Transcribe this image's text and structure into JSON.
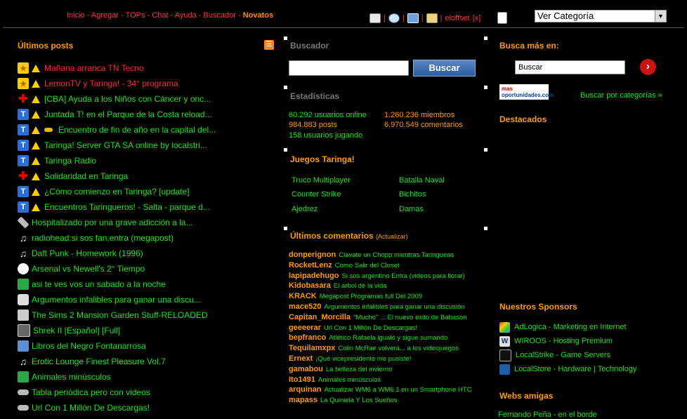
{
  "nav": {
    "items": [
      {
        "label": "Inicio",
        "active": false
      },
      {
        "label": "Agregar",
        "active": false
      },
      {
        "label": "TOPs",
        "active": false
      },
      {
        "label": "Chat",
        "active": false
      },
      {
        "label": "Ayuda",
        "active": false
      },
      {
        "label": "Buscador",
        "active": false
      },
      {
        "label": "Novatos",
        "active": true
      }
    ],
    "user": "eloffset",
    "close": "[x]",
    "category_select": "Ver Categoría"
  },
  "left": {
    "title": "Últimos posts",
    "posts": [
      {
        "title": "Mañana arranca TN Tecno",
        "icon": "star-icon",
        "color": "red",
        "warn": true
      },
      {
        "title": "LemonTV y Taringa! - 34° programa",
        "icon": "star-icon",
        "color": "red",
        "warn": true
      },
      {
        "title": "[CBA] Ayuda a los Niños con Cáncer y onc...",
        "icon": "red-cross-icon",
        "color": "green",
        "warn": true
      },
      {
        "title": "Juntada T! en el Parque de la Costa reload...",
        "icon": "taringa-t-icon",
        "color": "green",
        "warn": true
      },
      {
        "title": "Encuentro de fin de año en la capital del...",
        "icon": "taringa-t-icon",
        "color": "green",
        "warn": true,
        "key": true
      },
      {
        "title": "Taringa! Server GTA SA online by localstri...",
        "icon": "taringa-t-icon",
        "color": "green",
        "warn": true
      },
      {
        "title": "Taringa Radio",
        "icon": "taringa-t-icon",
        "color": "green",
        "warn": true
      },
      {
        "title": "Solidaridad en Taringa",
        "icon": "red-cross-icon",
        "color": "green",
        "warn": true
      },
      {
        "title": "¿Cómo comienzo en Taringa? [update]",
        "icon": "taringa-t-icon",
        "color": "green",
        "warn": true
      },
      {
        "title": "Encuentros Taringueros! - Salta - parque d...",
        "icon": "taringa-t-icon",
        "color": "green",
        "warn": true
      },
      {
        "title": "Hospitalizado por una grave adicción a la...",
        "icon": "bandage-icon",
        "color": "green",
        "warn": false
      },
      {
        "title": "radiohead:si sos fan,entra (megapost)",
        "icon": "music-note-icon",
        "color": "green",
        "warn": false
      },
      {
        "title": "Daft Punk - Homework (1996)",
        "icon": "music-note-icon",
        "color": "green",
        "warn": false
      },
      {
        "title": "Arsenal vs Newell's 2° Tiempo",
        "icon": "soccer-ball-icon",
        "color": "green",
        "warn": false
      },
      {
        "title": "asi te ves vos un sabado a la noche",
        "icon": "image-icon",
        "color": "green",
        "warn": false
      },
      {
        "title": "Argumentos infalibles para ganar una discu...",
        "icon": "chat-icon",
        "color": "green",
        "warn": false
      },
      {
        "title": "The Sims 2 Mansion Garden Stuff-RELOADED",
        "icon": "gamepad-icon",
        "color": "green",
        "warn": false
      },
      {
        "title": "Shrek II [Español] [Full]",
        "icon": "film-icon",
        "color": "green",
        "warn": false
      },
      {
        "title": "Libros del Negro Fontanarrosa",
        "icon": "book-icon",
        "color": "green",
        "warn": false
      },
      {
        "title": "Erotic Lounge Finest Pleasure Vol.7",
        "icon": "music-note-icon",
        "color": "green",
        "warn": false
      },
      {
        "title": "Animales minúsculos",
        "icon": "image-icon",
        "color": "green",
        "warn": false
      },
      {
        "title": "Tabla periódica pero con videos",
        "icon": "link-icon",
        "color": "green",
        "warn": false
      },
      {
        "title": "Url Con 1 Millón De Descargas!",
        "icon": "link-icon",
        "color": "green",
        "warn": false
      }
    ]
  },
  "middle": {
    "search_title": "Buscador",
    "search_button": "Buscar",
    "stats_title": "Estadísticas",
    "stats": [
      {
        "text": "60.292 usuarios online",
        "color": "green"
      },
      {
        "text": "1.260.236 miembros",
        "color": "orange"
      },
      {
        "text": "984.883 posts",
        "color": "orange"
      },
      {
        "text": "6.970.549 comentarios",
        "color": "orange"
      },
      {
        "text": "158 usuarios jugando",
        "color": "green"
      }
    ],
    "games_title": "Juegos Taringa!",
    "games": [
      "Truco Multiplayer",
      "Batalla Naval",
      "Counter Strike",
      "Bichitos",
      "Ajedrez",
      "Damas"
    ],
    "comments_title": "Últimos comentarios",
    "comments_update": "(Actualizar)",
    "comments": [
      {
        "user": "donperignon",
        "text": "Clavate un Chopp mientras Taringueas"
      },
      {
        "user": "RocketLenz",
        "text": "Como Salir del Closet"
      },
      {
        "user": "lapipadehugo",
        "text": "Si sos argentino Entra (videos para llorar)"
      },
      {
        "user": "Kidobasara",
        "text": "El arbol de la vida"
      },
      {
        "user": "KRACK",
        "text": "Megapost Programas full Del 2009"
      },
      {
        "user": "mace520",
        "text": "Argumentos infalibles para ganar una discusión"
      },
      {
        "user": "Capitan_Morcilla",
        "text": "\"Mucho\" ... El nuevo exito de Babason"
      },
      {
        "user": "geeeerar",
        "text": "Url Con 1 Millón De Descargas!"
      },
      {
        "user": "bepfranco",
        "text": "Atlético Rafaela igualó y sigue sumando"
      },
      {
        "user": "Tequilamxpx",
        "text": "Colin McRae volverá... a los videojuegos"
      },
      {
        "user": "Ernext",
        "text": "¡Qué vicepresidente me pusiste!"
      },
      {
        "user": "gamabou",
        "text": "La belleza del invierno"
      },
      {
        "user": "Ito1491",
        "text": "Animales minúsculos"
      },
      {
        "user": "arquinan",
        "text": "Actualizar WM6 a WM6.1 en un Smartphone HTC"
      },
      {
        "user": "mapass",
        "text": "La Quiniela Y Los Sueños"
      }
    ]
  },
  "right": {
    "search_title": "Busca más en:",
    "search_value": "Buscar",
    "logo_line1": "mas",
    "logo_line2": "oportunidades",
    "logo_line3": ".com",
    "categories_link": "Buscar por categorías »",
    "featured_title": "Destacados",
    "sponsors_title": "Nuestros Sponsors",
    "sponsors": [
      {
        "label": "AdLogica - Marketing en Internet",
        "icon": "adlogica-icon"
      },
      {
        "label": "WIROOS - Hosting Premium",
        "icon": "wiroos-icon"
      },
      {
        "label": "LocalStrike - Game Servers",
        "icon": "localstrike-icon"
      },
      {
        "label": "LocalStore - Hardware | Technology",
        "icon": "localstore-icon"
      }
    ],
    "friends_title": "Webs amigas",
    "friends": [
      "Fernando Peña - en el borde"
    ]
  }
}
